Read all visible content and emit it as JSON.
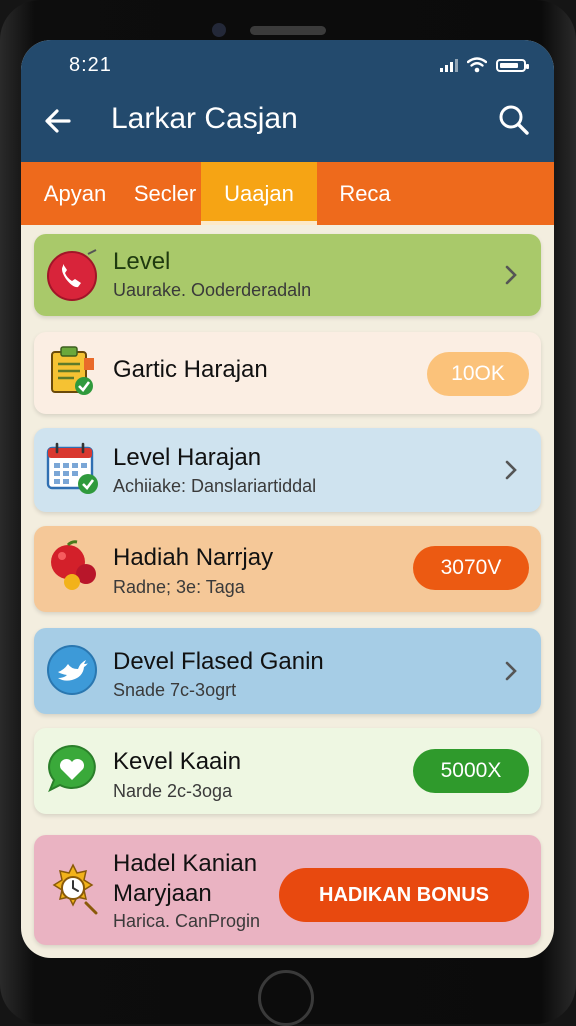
{
  "status": {
    "time": "8:21"
  },
  "header": {
    "title": "Larkar Casjan"
  },
  "tabs": [
    {
      "label": "Apyan"
    },
    {
      "label": "Secler"
    },
    {
      "label": "Uaajan"
    },
    {
      "label": "Reca"
    }
  ],
  "active_tab_index": 2,
  "cards": [
    {
      "title": "Level",
      "subtitle": "Uaurake. Ooderderadaln",
      "bg": "#a9c96a",
      "icon": "phone-icon"
    },
    {
      "title": "Gartic Harajan",
      "badge": "10OK",
      "bg": "#fbeee3",
      "badge_color": "#fbc27a",
      "badge_text_color": "#ffffff",
      "icon": "clipboard-check-icon"
    },
    {
      "title": "Level Harajan",
      "subtitle": "Achiiake: Danslariartiddal",
      "bg": "#cfe3ef",
      "icon": "calendar-check-icon"
    },
    {
      "title": "Hadiah Narrjay",
      "subtitle": "Radne; 3e: Taga",
      "badge": "3070V",
      "bg": "#f5c898",
      "badge_color": "#ec5a12",
      "icon": "fruit-icon"
    },
    {
      "title": "Devel Flased Ganin",
      "subtitle": "Snade 7c-3ogrt",
      "bg": "#a6cde6",
      "icon": "bird-icon"
    },
    {
      "title": "Kevel Kaain",
      "subtitle": "Narde 2c-3oga",
      "badge": "5000X",
      "bg": "#eef7e2",
      "badge_color": "#2f9a2c",
      "icon": "chat-heart-icon"
    },
    {
      "title": "Hadel Kanian Maryjaan",
      "subtitle": "Harica. CanProgin",
      "button": "HADIKAN BONUS",
      "bg": "#eab3c2",
      "button_color": "#e8490f",
      "icon": "stopwatch-icon"
    }
  ]
}
